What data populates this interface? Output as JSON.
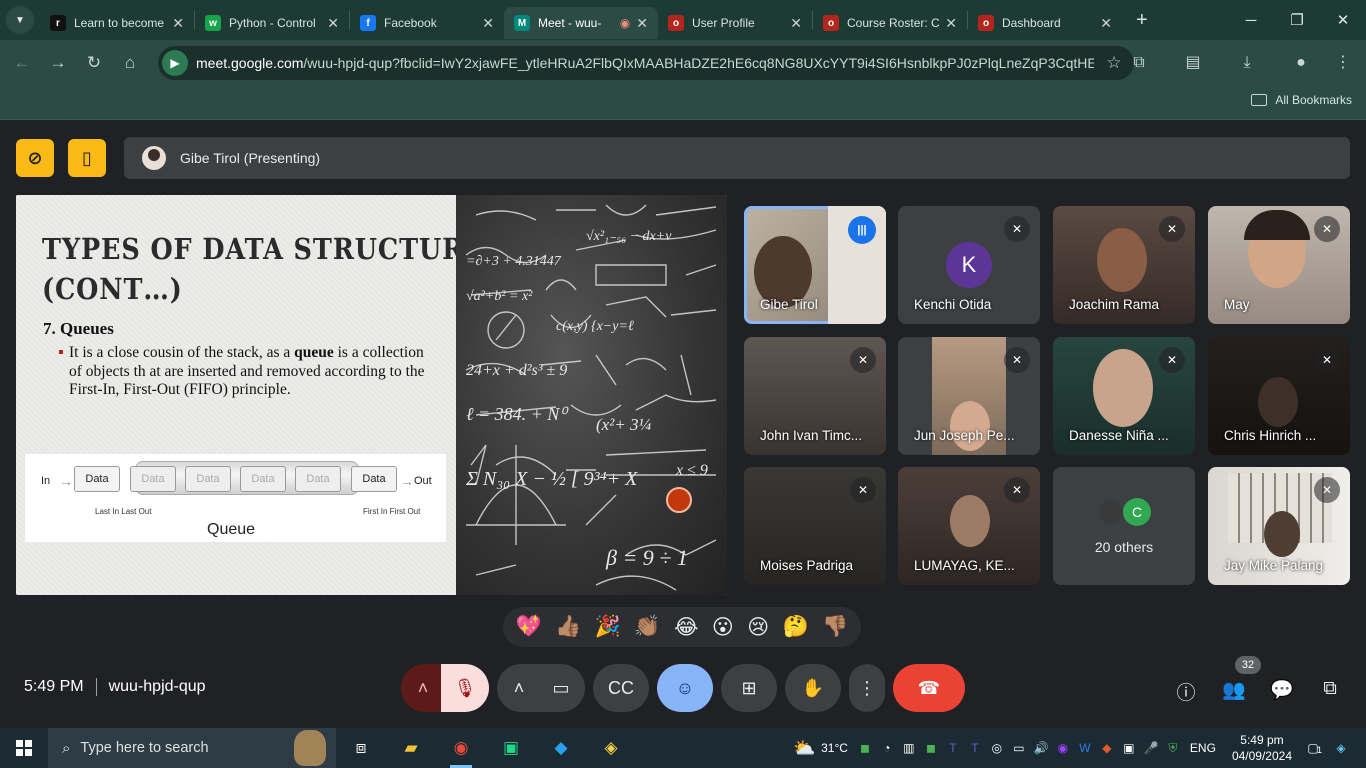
{
  "browser": {
    "tabs": [
      {
        "title": "Learn to become",
        "icon": "r",
        "icon_bg": "#111111"
      },
      {
        "title": "Python - Control",
        "icon": "w",
        "icon_bg": "#16a34a"
      },
      {
        "title": "Facebook",
        "icon": "f",
        "icon_bg": "#1877f2"
      },
      {
        "title": "Meet - wuu-",
        "icon": "M",
        "icon_bg": "#00897b",
        "active": true
      },
      {
        "title": "User Profile",
        "icon": "o",
        "icon_bg": "#b3261e"
      },
      {
        "title": "Course Roster: C",
        "icon": "o",
        "icon_bg": "#b3261e"
      },
      {
        "title": "Dashboard",
        "icon": "o",
        "icon_bg": "#b3261e"
      }
    ],
    "url_host": "meet.google.com",
    "url_path": "/wuu-hpjd-qup?fbclid=IwY2xjawFE_ytleHRuA2FlbQIxMAABHaDZE2hE6cq8NG8UXcYYT9i4SI6HsnblkpPJ0zPlqLneZqP3CqtHEtW6...",
    "bookmarks_label": "All Bookmarks"
  },
  "meet": {
    "presenter_label": "Gibe Tirol (Presenting)",
    "slide": {
      "title_line1": "TYPES OF DATA STRUCTURES",
      "title_line2": "(CONT…)",
      "heading": "7. Queues",
      "body_pre": "It is a close cousin of the stack, as a ",
      "body_bold": "queue",
      "body_post": " is a collection of objects th at are inserted and removed according to the First-In, First-Out (FIFO) principle.",
      "diagram": {
        "in": "In",
        "out": "Out",
        "data": "Data",
        "left_caption": "Last In Last Out",
        "right_caption": "First In First Out",
        "title": "Queue"
      }
    },
    "participants": [
      {
        "name": "Gibe Tirol",
        "speaking": true
      },
      {
        "name": "Kenchi Otida",
        "initial": "K"
      },
      {
        "name": "Joachim Rama"
      },
      {
        "name": "May"
      },
      {
        "name": "John Ivan Timc..."
      },
      {
        "name": "Jun Joseph Pe..."
      },
      {
        "name": "Danesse Niña ..."
      },
      {
        "name": "Chris Hinrich ..."
      },
      {
        "name": "Moises Padriga"
      },
      {
        "name": "LUMAYAG, KE..."
      },
      {
        "name": "20 others",
        "initial": "C"
      },
      {
        "name": "Jay Mike Palang"
      }
    ],
    "reactions": [
      "💖",
      "👍🏽",
      "🎉",
      "👏🏽",
      "😂",
      "😮",
      "😢",
      "🤔",
      "👎🏽"
    ],
    "time": "5:49 PM",
    "meeting_code": "wuu-hpjd-qup",
    "people_count": "32"
  },
  "taskbar": {
    "search_placeholder": "Type here to search",
    "weather": "31°C",
    "language": "ENG",
    "time": "5:49 pm",
    "date": "04/09/2024",
    "notification_count": "1"
  },
  "colors": {
    "accent_yellow": "#f9ba17",
    "end_call": "#ea4335",
    "tab_bar": "#1e3a34"
  }
}
